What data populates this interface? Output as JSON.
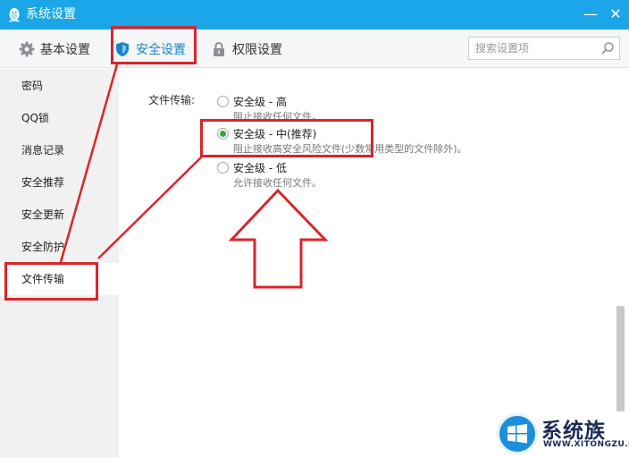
{
  "window": {
    "title": "系统设置",
    "minimize_glyph": "—",
    "close_glyph": "✕"
  },
  "toolbar": {
    "tabs": [
      {
        "label": "基本设置",
        "icon": "gear-icon"
      },
      {
        "label": "安全设置",
        "icon": "shield-icon",
        "active": true
      },
      {
        "label": "权限设置",
        "icon": "lock-icon"
      }
    ],
    "search": {
      "placeholder": "搜索设置项",
      "value": ""
    }
  },
  "sidebar": {
    "items": [
      {
        "label": "密码"
      },
      {
        "label": "QQ锁"
      },
      {
        "label": "消息记录"
      },
      {
        "label": "安全推荐"
      },
      {
        "label": "安全更新"
      },
      {
        "label": "安全防护"
      },
      {
        "label": "文件传输",
        "active": true
      }
    ]
  },
  "file_transfer": {
    "label": "文件传输:",
    "options": [
      {
        "title": "安全级 - 高",
        "desc": "阻止接收任何文件。",
        "checked": false
      },
      {
        "title": "安全级 - 中(推荐)",
        "desc": "阻止接收高安全风险文件(少数常用类型的文件除外)。",
        "checked": true
      },
      {
        "title": "安全级 - 低",
        "desc": "允许接收任何文件。",
        "checked": false
      }
    ]
  },
  "colors": {
    "titlebar": "#1aa6e8",
    "accent": "#1a84c8",
    "annotation": "#d9252b",
    "radio_checked": "#3aa63a"
  },
  "watermark": {
    "brand": "系统族",
    "url": "WWW.XITONGZU.COM"
  }
}
